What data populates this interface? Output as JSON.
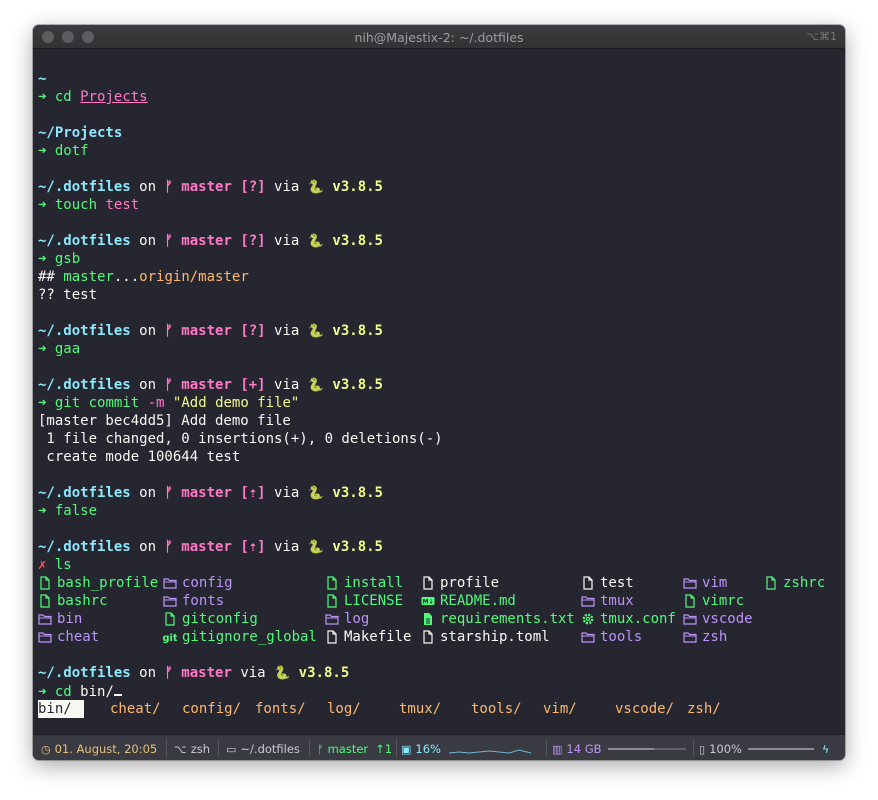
{
  "window": {
    "title": "nih@Majestix-2: ~/.dotfiles",
    "shortcut": "⌥⌘1"
  },
  "colors": {
    "background": "#262631",
    "prompt_dir": "#8be9fd",
    "arrow": "#50fa7b",
    "branch": "#ff79c6",
    "python": "#f1fa8c",
    "orange": "#ffb86c",
    "error": "#ff5555",
    "folder": "#bd93f9"
  },
  "terminal": {
    "home_dir": "~",
    "cd_projects": {
      "cmd": "cd",
      "arg": "Projects"
    },
    "projects_dir": "~/Projects",
    "dotf_cmd": "dotf",
    "prompt": {
      "dir": "~/.dotfiles",
      "on": "on",
      "branch_icon": "ᚠ",
      "branch": "master",
      "via": "via",
      "python_icon": "🐍",
      "version": "v3.8.5"
    },
    "status_untracked": "[?]",
    "status_staged": "[+]",
    "status_ahead": "[⇡]",
    "touch": {
      "cmd": "touch",
      "arg": "test"
    },
    "gsb": "gsb",
    "gsb_out": {
      "prefix": "##",
      "branch": "master",
      "dots": "...",
      "remote": "origin/master",
      "untracked_prefix": "??",
      "untracked_file": "test"
    },
    "gaa": "gaa",
    "commit": {
      "git": "git",
      "sub": "commit",
      "flag": "-m",
      "msg": "\"Add demo file\""
    },
    "commit_out": [
      "[master bec4dd5] Add demo file",
      " 1 file changed, 0 insertions(+), 0 deletions(-)",
      " create mode 100644 test"
    ],
    "false_cmd": "false",
    "err_mark": "✗",
    "ls_cmd": "ls",
    "ls_items": [
      {
        "name": "bash_profile",
        "kind": "file",
        "col": 0,
        "row": 0
      },
      {
        "name": "bashrc",
        "kind": "file",
        "col": 0,
        "row": 1
      },
      {
        "name": "bin",
        "kind": "folder",
        "col": 0,
        "row": 2
      },
      {
        "name": "cheat",
        "kind": "folder",
        "col": 0,
        "row": 3
      },
      {
        "name": "config",
        "kind": "folder",
        "col": 1,
        "row": 0
      },
      {
        "name": "fonts",
        "kind": "folder",
        "col": 1,
        "row": 1
      },
      {
        "name": "gitconfig",
        "kind": "file",
        "col": 1,
        "row": 2
      },
      {
        "name": "gitignore_global",
        "kind": "git",
        "col": 1,
        "row": 3
      },
      {
        "name": "install",
        "kind": "file",
        "col": 2,
        "row": 0
      },
      {
        "name": "LICENSE",
        "kind": "file",
        "col": 2,
        "row": 1
      },
      {
        "name": "log",
        "kind": "folder",
        "col": 2,
        "row": 2
      },
      {
        "name": "Makefile",
        "kind": "plain",
        "col": 2,
        "row": 3
      },
      {
        "name": "profile",
        "kind": "plain",
        "col": 3,
        "row": 0
      },
      {
        "name": "README.md",
        "kind": "md",
        "col": 3,
        "row": 1
      },
      {
        "name": "requirements.txt",
        "kind": "txt",
        "col": 3,
        "row": 2
      },
      {
        "name": "starship.toml",
        "kind": "plain",
        "col": 3,
        "row": 3
      },
      {
        "name": "test",
        "kind": "plain",
        "col": 4,
        "row": 0
      },
      {
        "name": "tmux",
        "kind": "folder",
        "col": 4,
        "row": 1
      },
      {
        "name": "tmux.conf",
        "kind": "gear",
        "col": 4,
        "row": 2
      },
      {
        "name": "tools",
        "kind": "folder",
        "col": 4,
        "row": 3
      },
      {
        "name": "vim",
        "kind": "folder",
        "col": 5,
        "row": 0
      },
      {
        "name": "vimrc",
        "kind": "file",
        "col": 5,
        "row": 1
      },
      {
        "name": "vscode",
        "kind": "folder",
        "col": 5,
        "row": 2
      },
      {
        "name": "zsh",
        "kind": "folder",
        "col": 5,
        "row": 3
      },
      {
        "name": "zshrc",
        "kind": "file",
        "col": 6,
        "row": 0
      }
    ],
    "cd_bin": {
      "cmd": "cd",
      "arg": "bin/"
    },
    "completions": [
      "bin/",
      "cheat/",
      "config/",
      "fonts/",
      "log/",
      "tmux/",
      "tools/",
      "vim/",
      "vscode/",
      "zsh/"
    ]
  },
  "statusbar": {
    "clock_icon": "clock-icon",
    "date": "01. August, 20:05",
    "shell": "zsh",
    "path": "~/.dotfiles",
    "branch": "master",
    "ahead": "↑1",
    "cpu": "16%",
    "memory": "14 GB",
    "battery": "100%",
    "battery_level": 1.0
  }
}
